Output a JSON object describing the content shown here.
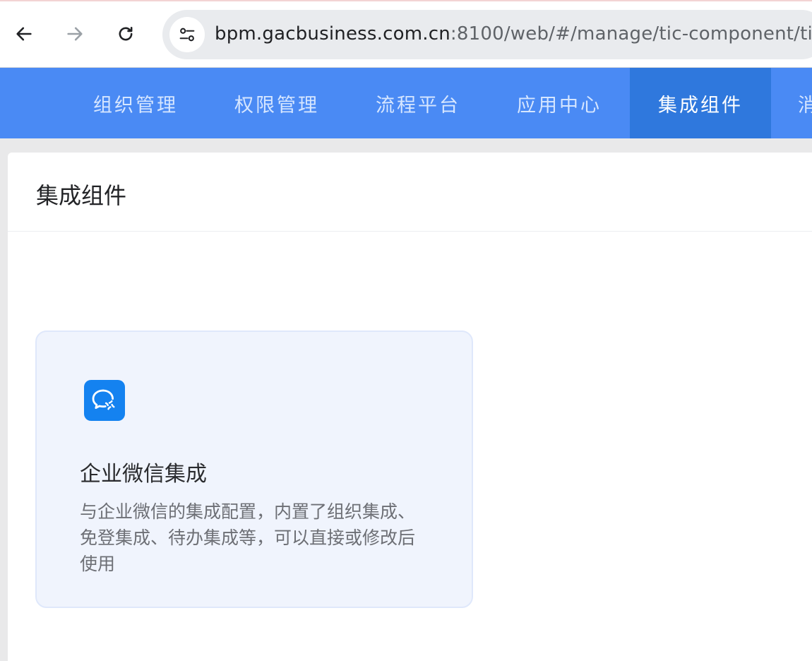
{
  "browser": {
    "url_host": "bpm.gacbusiness.com.cn",
    "url_rest": ":8100/web/#/manage/tic-component/ti"
  },
  "icons": {
    "back": "arrow-left-icon",
    "forward": "arrow-right-icon",
    "reload": "reload-icon",
    "site_info": "tune-icon",
    "wechat_work": "wechat-work-icon"
  },
  "colors": {
    "nav_bg": "#4a8af4",
    "nav_active": "#2f78dd",
    "card_bg": "#f0f4fd",
    "icon_bg": "#1482f0"
  },
  "topnav": {
    "items": [
      {
        "label": "组织管理"
      },
      {
        "label": "权限管理"
      },
      {
        "label": "流程平台"
      },
      {
        "label": "应用中心"
      },
      {
        "label": "集成组件",
        "active": true
      },
      {
        "label": "消"
      }
    ]
  },
  "page": {
    "title": "集成组件"
  },
  "card": {
    "title": "企业微信集成",
    "description": "与企业微信的集成配置，内置了组织集成、免登集成、待办集成等，可以直接或修改后使用"
  }
}
